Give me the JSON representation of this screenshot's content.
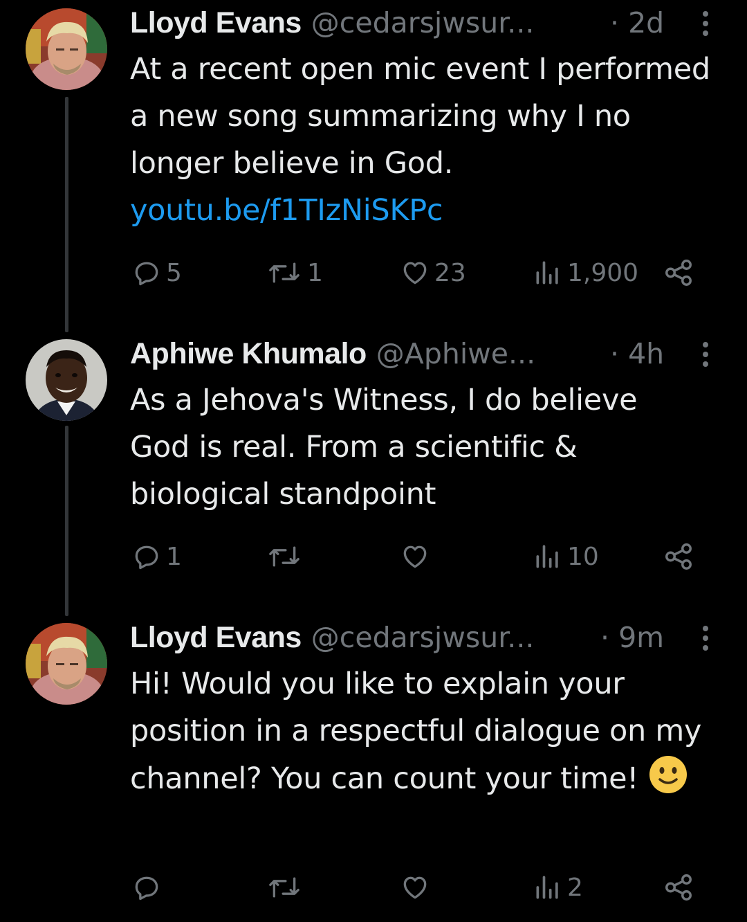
{
  "tweets": [
    {
      "name": "Lloyd Evans",
      "handle": "@cedarsjwsur...",
      "time": "· 2d",
      "text": "At a recent open mic event I performed a new song summarizing why I no longer believe in God.",
      "link": "youtu.be/f1TIzNiSKPc",
      "replies": "5",
      "reposts": "1",
      "likes": "23",
      "views": "1,900"
    },
    {
      "name": "Aphiwe Khumalo",
      "handle": "@Aphiwe...",
      "time": "· 4h",
      "text": "As a Jehova's Witness, I do believe God is real. From a scientific & biological standpoint",
      "replies": "1",
      "reposts": "",
      "likes": "",
      "views": "10"
    },
    {
      "name": "Lloyd Evans",
      "handle": "@cedarsjwsur...",
      "time": "· 9m",
      "text": "Hi! Would you like to explain your position in a respectful dialogue on my channel? You can count your time!",
      "emoji": "slightly-smiling-face",
      "replies": "",
      "reposts": "",
      "likes": "",
      "views": "2"
    }
  ],
  "colors": {
    "background": "#000000",
    "text_primary": "#e7e9ea",
    "text_secondary": "#71767b",
    "link": "#1d9bf0",
    "thread_line": "#333639"
  },
  "icons": [
    "reply-icon",
    "repost-icon",
    "like-icon",
    "views-icon",
    "share-icon",
    "more-icon"
  ]
}
